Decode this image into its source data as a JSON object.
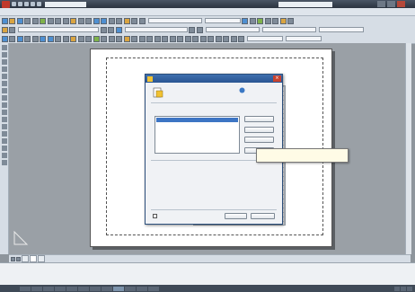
{
  "app": {
    "title": "",
    "workspace": "",
    "search_placeholder": ""
  },
  "menu": [
    "",
    "",
    "",
    "",
    "",
    "",
    "",
    "",
    "",
    "",
    "",
    "",
    ""
  ],
  "toolbar": {
    "layer_dropdown": "",
    "style_dropdown": "",
    "color_dropdown": ""
  },
  "tabs": [
    "",
    "",
    ""
  ],
  "command_lines": [
    "",
    "",
    ""
  ],
  "status": {
    "coords": "",
    "buttons": [
      "",
      "",
      "",
      "",
      "",
      "",
      "",
      "",
      "",
      "",
      "",
      ""
    ]
  },
  "dialog": {
    "title": "",
    "current_layout_label": "",
    "current_layout_value": "",
    "help_link_line1": "",
    "help_link_line2": "",
    "section_page_setups": "",
    "current_page_setup_label": "",
    "current_page_setup_value": "",
    "list_items": [
      ""
    ],
    "btn_set_current": "",
    "btn_new": "",
    "btn_modify": "",
    "btn_import": "",
    "section_details": "",
    "details": [
      {
        "label": "",
        "value": ""
      },
      {
        "label": "",
        "value": ""
      },
      {
        "label": "",
        "value": ""
      },
      {
        "label": "",
        "value": ""
      },
      {
        "label": "",
        "value": ""
      }
    ],
    "show_on_new_layout": "",
    "btn_close": "",
    "btn_help": ""
  },
  "tooltip": {
    "text": ""
  },
  "colors": {
    "dialog_title": "#2a5592",
    "selection": "#3d75c4",
    "link": "#2456a6"
  }
}
